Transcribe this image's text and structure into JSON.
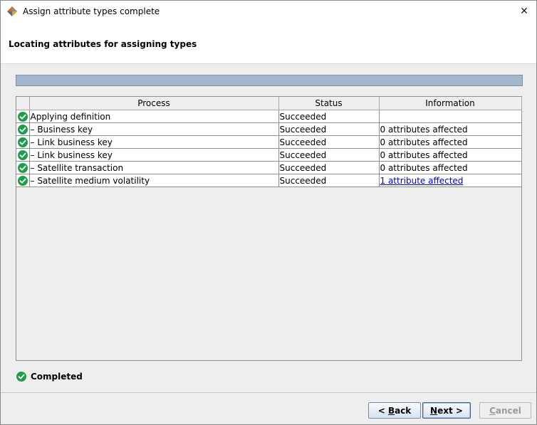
{
  "window": {
    "title": "Assign attribute types complete",
    "close_glyph": "✕"
  },
  "header": {
    "title": "Locating attributes for assigning types"
  },
  "progress": {
    "fraction": 1.0
  },
  "table": {
    "columns": [
      "",
      "Process",
      "Status",
      "Information"
    ],
    "rows": [
      {
        "icon": "check-circle-icon",
        "process": "Applying definition",
        "status": "Succeeded",
        "information": "",
        "info_is_link": false
      },
      {
        "icon": "check-circle-icon",
        "process": "– Business key",
        "status": "Succeeded",
        "information": "0 attributes affected",
        "info_is_link": false
      },
      {
        "icon": "check-circle-icon",
        "process": "– Link business key",
        "status": "Succeeded",
        "information": "0 attributes affected",
        "info_is_link": false
      },
      {
        "icon": "check-circle-icon",
        "process": "– Link business key",
        "status": "Succeeded",
        "information": "0 attributes affected",
        "info_is_link": false
      },
      {
        "icon": "check-circle-icon",
        "process": "– Satellite transaction",
        "status": "Succeeded",
        "information": "0 attributes affected",
        "info_is_link": false
      },
      {
        "icon": "check-circle-icon",
        "process": "– Satellite medium volatility",
        "status": "Succeeded",
        "information": "1 attribute affected",
        "info_is_link": true
      }
    ]
  },
  "status": {
    "label": "Completed",
    "icon": "check-circle-icon"
  },
  "buttons": {
    "back": {
      "label": "< Back",
      "mnemonic": "B"
    },
    "next": {
      "label": "Next >",
      "mnemonic": "N"
    },
    "cancel": {
      "label": "Cancel",
      "mnemonic": "C",
      "enabled": false
    }
  },
  "colors": {
    "success_green": "#1e9e4a",
    "progress_fill": "#a3b8cc",
    "link": "#0000cc"
  }
}
